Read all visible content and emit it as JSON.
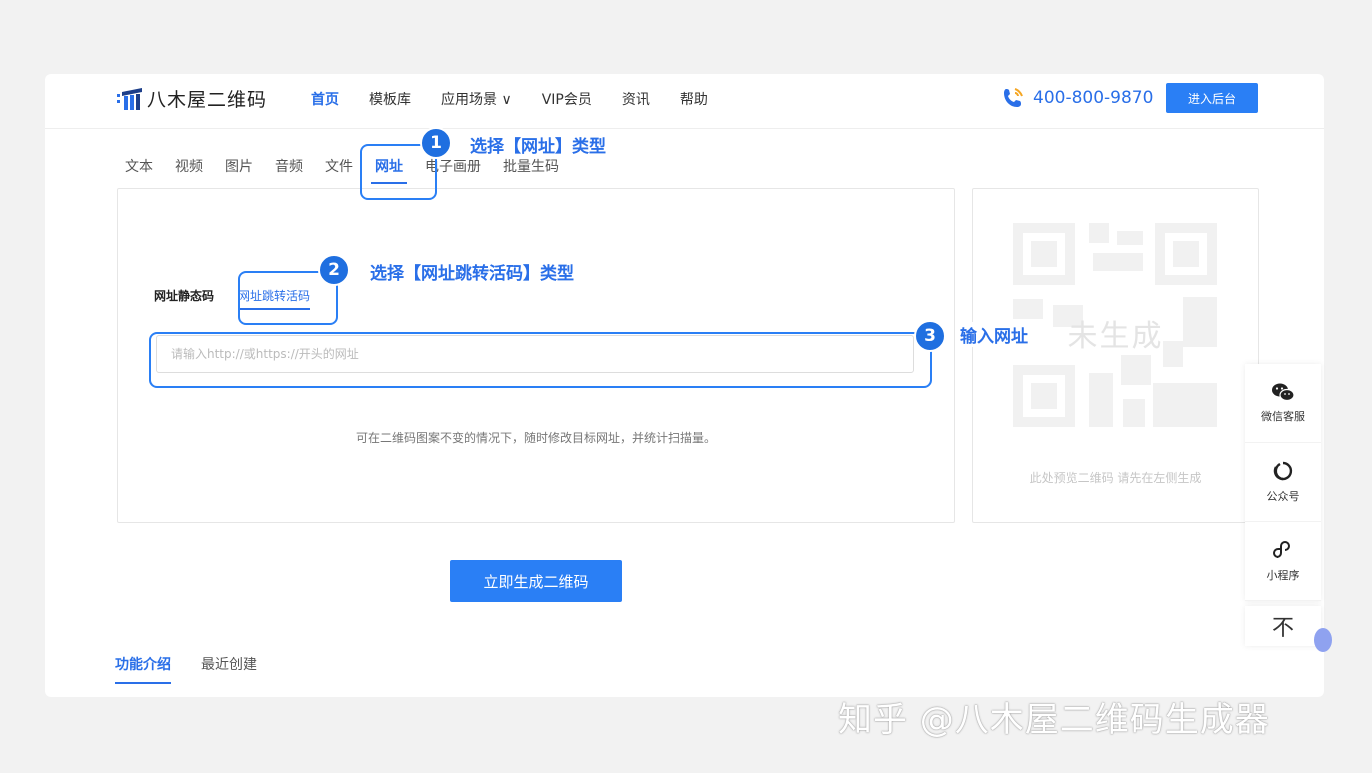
{
  "header": {
    "brand": "八木屋二维码",
    "nav": [
      "首页",
      "模板库",
      "应用场景 ∨",
      "VIP会员",
      "资讯",
      "帮助"
    ],
    "phone": "400-800-9870",
    "admin_button": "进入后台"
  },
  "type_tabs": [
    "文本",
    "视频",
    "图片",
    "音频",
    "文件",
    "网址",
    "电子画册",
    "批量生码"
  ],
  "callouts": {
    "step1": {
      "num": "1",
      "text": "选择【网址】类型"
    },
    "step2": {
      "num": "2",
      "text": "选择【网址跳转活码】类型"
    },
    "step3": {
      "num": "3",
      "text": "输入网址"
    }
  },
  "form": {
    "sub_tabs": [
      "网址静态码",
      "网址跳转活码"
    ],
    "url_placeholder": "请输入http://或https://开头的网址",
    "hint": "可在二维码图案不变的情况下，随时修改目标网址，并统计扫描量。"
  },
  "preview": {
    "label": "未生成",
    "note": "此处预览二维码 请先在左侧生成"
  },
  "generate_button": "立即生成二维码",
  "bottom_tabs": [
    "功能介绍",
    "最近创建"
  ],
  "side_float": {
    "items": [
      {
        "label": "微信客服",
        "icon": "wechat-icon"
      },
      {
        "label": "公众号",
        "icon": "official-account-icon"
      },
      {
        "label": "小程序",
        "icon": "mini-program-icon"
      }
    ],
    "back_to_top": "不"
  },
  "watermark": "知乎 @八木屋二维码生成器",
  "colors": {
    "accent": "#2a7ff5",
    "brand_text": "#2a6fe8",
    "background": "#f2f2f2"
  }
}
